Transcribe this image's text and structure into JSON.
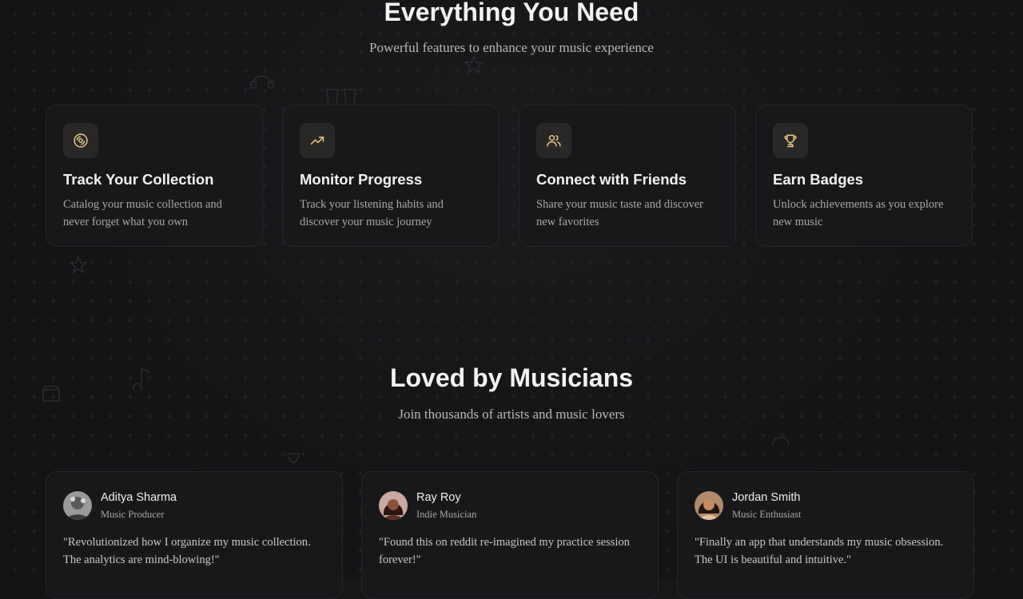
{
  "features_section": {
    "title": "Everything You Need",
    "subtitle": "Powerful features to enhance your music experience",
    "cards": [
      {
        "icon": "disc-icon",
        "title": "Track Your Collection",
        "description": "Catalog your music collection and never forget what you own"
      },
      {
        "icon": "trending-up-icon",
        "title": "Monitor Progress",
        "description": "Track your listening habits and discover your music journey"
      },
      {
        "icon": "users-icon",
        "title": "Connect with Friends",
        "description": "Share your music taste and discover new favorites"
      },
      {
        "icon": "trophy-icon",
        "title": "Earn Badges",
        "description": "Unlock achievements as you explore new music"
      }
    ]
  },
  "testimonials_section": {
    "title": "Loved by Musicians",
    "subtitle": "Join thousands of artists and music lovers",
    "items": [
      {
        "name": "Aditya Sharma",
        "role": "Music Producer",
        "quote": "\"Revolutionized how I organize my music collection. The analytics are mind-blowing!\""
      },
      {
        "name": "Ray Roy",
        "role": "Indie Musician",
        "quote": "\"Found this on reddit re-imagined my practice session forever!\""
      },
      {
        "name": "Jordan Smith",
        "role": "Music Enthusiast",
        "quote": "\"Finally an app that understands my music obsession. The UI is beautiful and intuitive.\""
      }
    ]
  },
  "colors": {
    "background": "#141416",
    "card": "#18181b",
    "accent": "#e8c98a"
  }
}
